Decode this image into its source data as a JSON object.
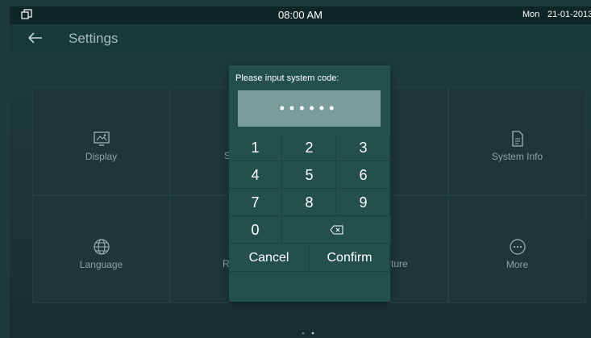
{
  "statusbar": {
    "time": "08:00 AM",
    "day": "Mon",
    "date": "21-01-2013"
  },
  "header": {
    "title": "Settings"
  },
  "tiles": [
    {
      "label": "Display",
      "icon": "display-icon"
    },
    {
      "label": "System Info",
      "icon": "info-icon"
    },
    {
      "label": "Language",
      "icon": "language-icon"
    },
    {
      "label": "More",
      "icon": "more-icon"
    }
  ],
  "partials": {
    "left_top": "S",
    "left_bottom": "R",
    "right_bottom": "ture"
  },
  "dialog": {
    "prompt": "Please input system code:",
    "code_mask": "••••••",
    "keys": [
      "1",
      "2",
      "3",
      "4",
      "5",
      "6",
      "7",
      "8",
      "9",
      "0"
    ],
    "cancel": "Cancel",
    "confirm": "Confirm"
  },
  "colors": {
    "accent_dialog": "#24504c",
    "code_box": "#7a9d9b",
    "background": "#1b3434"
  }
}
